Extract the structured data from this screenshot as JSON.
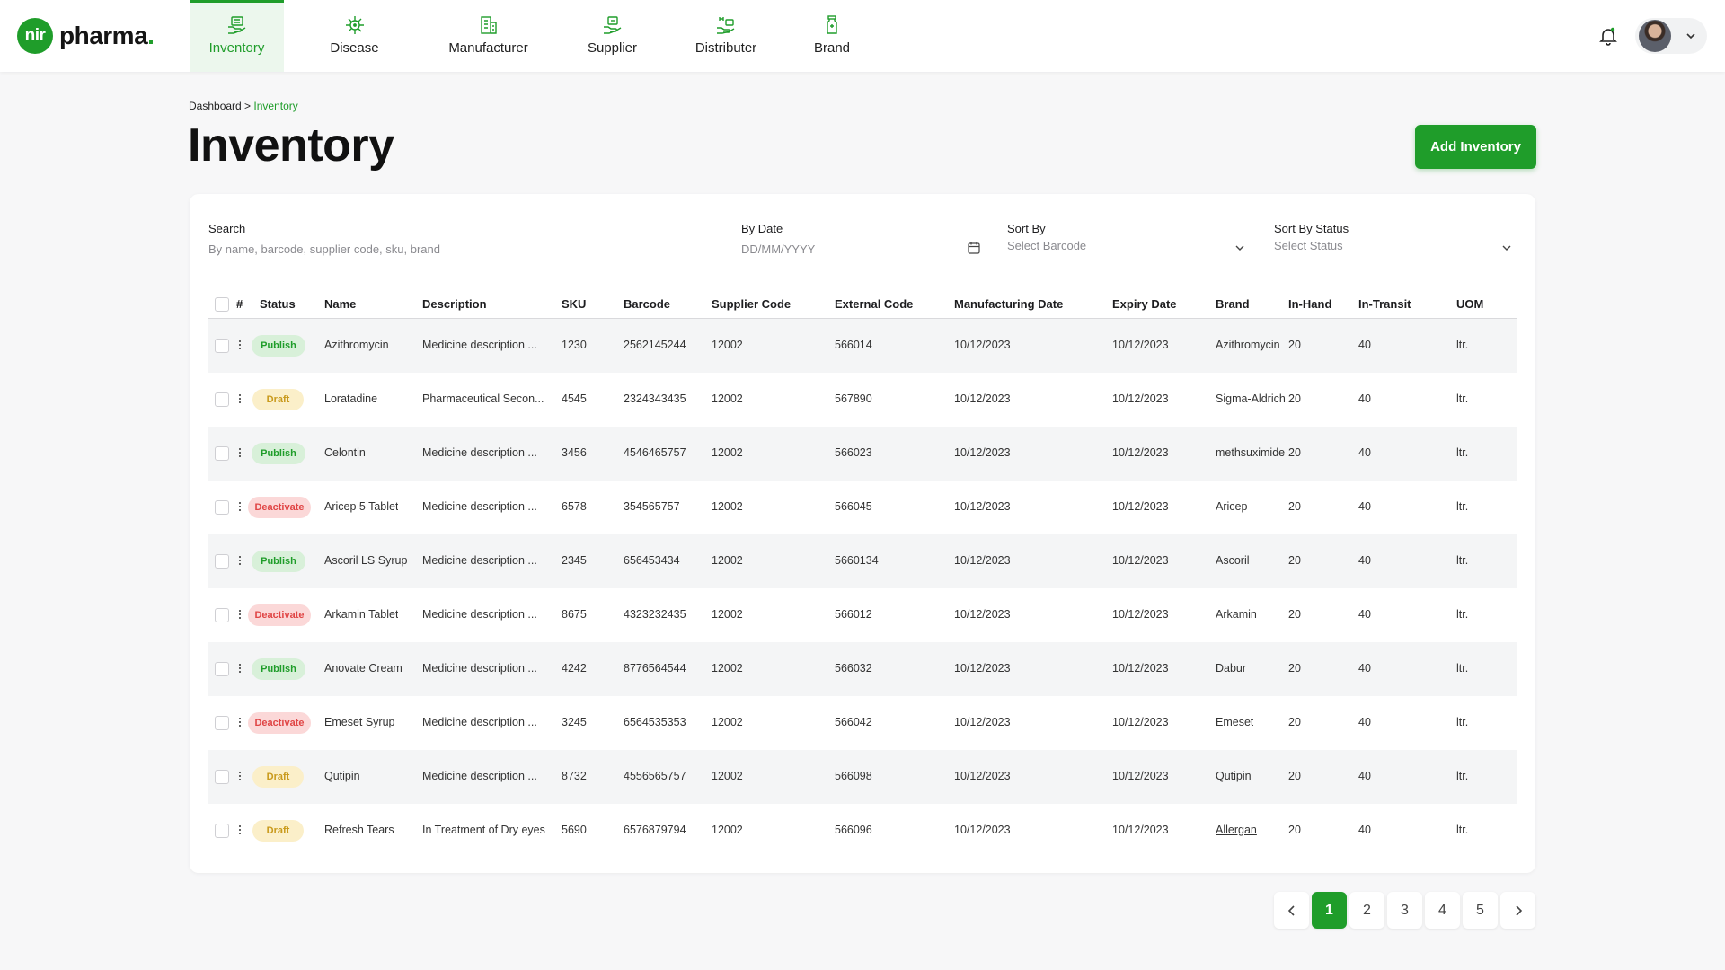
{
  "brand": {
    "logo_mark": "nir",
    "logo_word": "pharma",
    "logo_dot": "."
  },
  "nav": [
    {
      "label": "Inventory",
      "icon": "inventory-icon",
      "active": true
    },
    {
      "label": "Disease",
      "icon": "virus-icon",
      "active": false
    },
    {
      "label": "Manufacturer",
      "icon": "building-icon",
      "active": false
    },
    {
      "label": "Supplier",
      "icon": "supplier-icon",
      "active": false
    },
    {
      "label": "Distributer",
      "icon": "distributer-icon",
      "active": false
    },
    {
      "label": "Brand",
      "icon": "bottle-icon",
      "active": false
    }
  ],
  "breadcrumb": {
    "root": "Dashboard",
    "separator": " > ",
    "current": "Inventory"
  },
  "page": {
    "title": "Inventory",
    "add_label": "Add Inventory"
  },
  "filters": {
    "search": {
      "label": "Search",
      "placeholder": "By name, barcode, supplier code, sku, brand"
    },
    "date": {
      "label": "By Date",
      "placeholder": "DD/MM/YYYY"
    },
    "sort_by": {
      "label": "Sort By",
      "placeholder": "Select Barcode"
    },
    "sort_status": {
      "label": "Sort By Status",
      "placeholder": "Select Status"
    }
  },
  "table": {
    "headers": [
      "#",
      "Status",
      "Name",
      "Description",
      "SKU",
      "Barcode",
      "Supplier Code",
      "External Code",
      "Manufacturing Date",
      "Expiry Date",
      "Brand",
      "In-Hand",
      "In-Transit",
      "UOM"
    ],
    "rows": [
      {
        "status": "Publish",
        "name": "Azithromycin",
        "description": "Medicine description ...",
        "sku": "1230",
        "barcode": "2562145244",
        "supplier_code": "12002",
        "external_code": "566014",
        "mfg_date": "10/12/2023",
        "exp_date": "10/12/2023",
        "brand": "Azithromycin",
        "in_hand": "20",
        "in_transit": "40",
        "uom": "ltr."
      },
      {
        "status": "Draft",
        "name": "Loratadine",
        "description": "Pharmaceutical Secon...",
        "sku": "4545",
        "barcode": "2324343435",
        "supplier_code": "12002",
        "external_code": "567890",
        "mfg_date": "10/12/2023",
        "exp_date": "10/12/2023",
        "brand": "Sigma-Aldrich",
        "in_hand": "20",
        "in_transit": "40",
        "uom": "ltr."
      },
      {
        "status": "Publish",
        "name": "Celontin",
        "description": "Medicine description ...",
        "sku": "3456",
        "barcode": "4546465757",
        "supplier_code": "12002",
        "external_code": "566023",
        "mfg_date": "10/12/2023",
        "exp_date": "10/12/2023",
        "brand": "methsuximide",
        "in_hand": "20",
        "in_transit": "40",
        "uom": "ltr."
      },
      {
        "status": "Deactivate",
        "name": "Aricep 5 Tablet",
        "description": "Medicine description ...",
        "sku": "6578",
        "barcode": "354565757",
        "supplier_code": "12002",
        "external_code": "566045",
        "mfg_date": "10/12/2023",
        "exp_date": "10/12/2023",
        "brand": "Aricep",
        "in_hand": "20",
        "in_transit": "40",
        "uom": "ltr."
      },
      {
        "status": "Publish",
        "name": "Ascoril LS Syrup",
        "description": "Medicine description ...",
        "sku": "2345",
        "barcode": "656453434",
        "supplier_code": "12002",
        "external_code": "5660134",
        "mfg_date": "10/12/2023",
        "exp_date": "10/12/2023",
        "brand": "Ascoril",
        "in_hand": "20",
        "in_transit": "40",
        "uom": "ltr."
      },
      {
        "status": "Deactivate",
        "name": "Arkamin Tablet",
        "description": "Medicine description ...",
        "sku": "8675",
        "barcode": "4323232435",
        "supplier_code": "12002",
        "external_code": "566012",
        "mfg_date": "10/12/2023",
        "exp_date": "10/12/2023",
        "brand": "Arkamin",
        "in_hand": "20",
        "in_transit": "40",
        "uom": "ltr."
      },
      {
        "status": "Publish",
        "name": "Anovate Cream",
        "description": "Medicine description ...",
        "sku": "4242",
        "barcode": "8776564544",
        "supplier_code": "12002",
        "external_code": "566032",
        "mfg_date": "10/12/2023",
        "exp_date": "10/12/2023",
        "brand": "Dabur",
        "in_hand": "20",
        "in_transit": "40",
        "uom": "ltr."
      },
      {
        "status": "Deactivate",
        "name": "Emeset Syrup",
        "description": "Medicine description ...",
        "sku": "3245",
        "barcode": "6564535353",
        "supplier_code": "12002",
        "external_code": "566042",
        "mfg_date": "10/12/2023",
        "exp_date": "10/12/2023",
        "brand": "Emeset",
        "in_hand": "20",
        "in_transit": "40",
        "uom": "ltr."
      },
      {
        "status": "Draft",
        "name": "Qutipin",
        "description": "Medicine description ...",
        "sku": "8732",
        "barcode": "4556565757",
        "supplier_code": "12002",
        "external_code": "566098",
        "mfg_date": "10/12/2023",
        "exp_date": "10/12/2023",
        "brand": "Qutipin",
        "in_hand": "20",
        "in_transit": "40",
        "uom": "ltr."
      },
      {
        "status": "Draft",
        "name": "Refresh Tears",
        "description": "In Treatment of Dry eyes",
        "sku": "5690",
        "barcode": "6576879794",
        "supplier_code": "12002",
        "external_code": "566096",
        "mfg_date": "10/12/2023",
        "exp_date": "10/12/2023",
        "brand": "Allergan",
        "in_hand": "20",
        "in_transit": "40",
        "uom": "ltr."
      }
    ]
  },
  "pagination": {
    "pages": [
      "1",
      "2",
      "3",
      "4",
      "5"
    ],
    "current": "1"
  },
  "colors": {
    "accent": "#1f9d2a",
    "publish": "#1f9d2a",
    "draft": "#c99a1c",
    "deactivate": "#e04545"
  }
}
